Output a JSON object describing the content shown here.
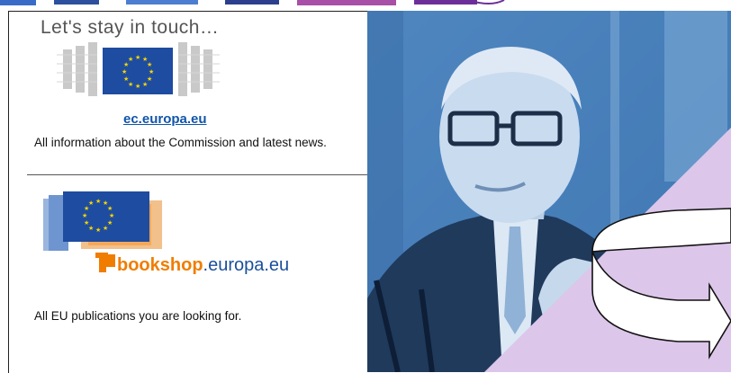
{
  "heading": "Let's stay in touch…",
  "ec": {
    "link": "ec.europa.eu",
    "description": "All information about the Commission and latest news."
  },
  "bookshop": {
    "brand_bold": "bookshop",
    "brand_rest": ".europa.eu",
    "description": "All EU publications you are looking for."
  },
  "colors": {
    "eu_blue": "#1e4ca0",
    "eu_star": "#f6d500",
    "photo_tint": "#5b8fc4",
    "accent_purple": "#dcc6ea",
    "bookshop_orange": "#f07d00"
  },
  "icons": [
    "ec-logo-icon",
    "eu-flag-icon",
    "bookshop-logo-icon",
    "circular-arrow-icon"
  ]
}
